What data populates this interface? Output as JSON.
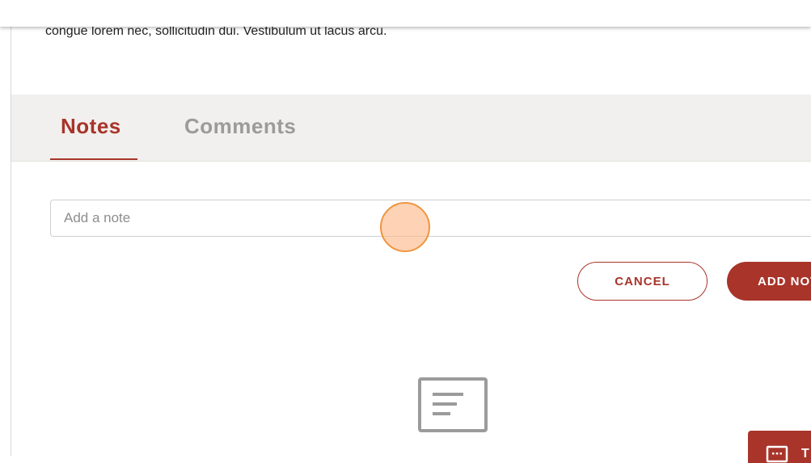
{
  "intro": {
    "text": "congue lorem nec, sollicitudin dui. Vestibulum ut lacus arcu."
  },
  "tabs": [
    {
      "label": "Notes",
      "active": true
    },
    {
      "label": "Comments",
      "active": false
    }
  ],
  "note_input": {
    "placeholder": "Add a note",
    "value": ""
  },
  "buttons": {
    "cancel_label": "CANCEL",
    "add_label": "ADD NOTE"
  },
  "empty_state": {
    "icon": "note-icon"
  },
  "feedback": {
    "icon": "chat-icon",
    "label": "T"
  },
  "colors": {
    "accent": "#a8342a",
    "tab_inactive": "#9b9b9b",
    "tabs_background": "#f1f0ee",
    "cursor_highlight": "#f0953f"
  }
}
